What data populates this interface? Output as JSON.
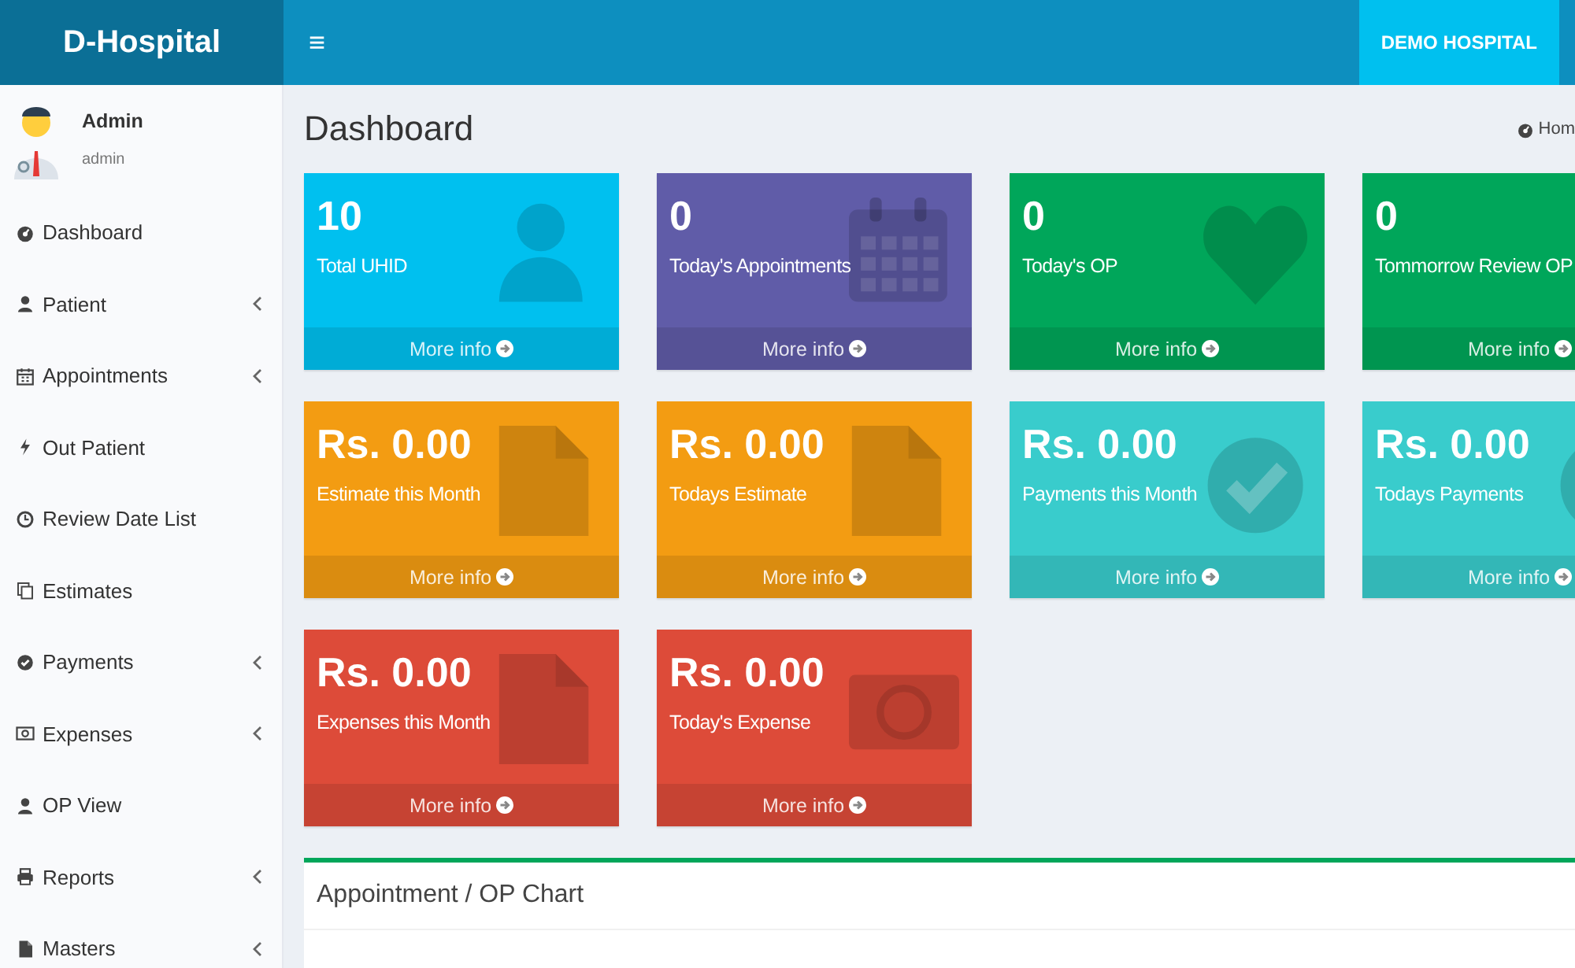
{
  "header": {
    "logo": "D-Hospital",
    "menu_toggle": "≡",
    "hospital_button": "DEMO HOSPITAL"
  },
  "user": {
    "name": "Admin",
    "role": "admin"
  },
  "sidebar": {
    "items": [
      {
        "label": "Dashboard",
        "kind": "dashboard",
        "submenu": false
      },
      {
        "label": "Patient",
        "kind": "user",
        "submenu": true
      },
      {
        "label": "Appointments",
        "kind": "calendar",
        "submenu": true
      },
      {
        "label": "Out Patient",
        "kind": "bolt",
        "submenu": false
      },
      {
        "label": "Review Date List",
        "kind": "clock",
        "submenu": false
      },
      {
        "label": "Estimates",
        "kind": "copy",
        "submenu": false
      },
      {
        "label": "Payments",
        "kind": "check",
        "submenu": true
      },
      {
        "label": "Expenses",
        "kind": "money",
        "submenu": true
      },
      {
        "label": "OP View",
        "kind": "user",
        "submenu": false
      },
      {
        "label": "Reports",
        "kind": "print",
        "submenu": true
      },
      {
        "label": "Masters",
        "kind": "file",
        "submenu": true
      }
    ]
  },
  "page": {
    "title": "Dashboard",
    "breadcrumb": "Hom"
  },
  "cards": [
    {
      "value": "10",
      "label": "Total UHID",
      "link": "More info",
      "color": "#00c0ef",
      "kind": "user"
    },
    {
      "value": "0",
      "label": "Today's Appointments",
      "link": "More info",
      "color": "#605ca8",
      "kind": "calendar"
    },
    {
      "value": "0",
      "label": "Today's OP",
      "link": "More info",
      "color": "#00a65a",
      "kind": "heart"
    },
    {
      "value": "0",
      "label": "Tommorrow Review OP",
      "link": "More info",
      "color": "#00a65a",
      "kind": "none"
    },
    {
      "value": "Rs. 0.00",
      "label": "Estimate this Month",
      "link": "More info",
      "color": "#f39c12",
      "kind": "file"
    },
    {
      "value": "Rs. 0.00",
      "label": "Todays Estimate",
      "link": "More info",
      "color": "#f39c12",
      "kind": "file"
    },
    {
      "value": "Rs. 0.00",
      "label": "Payments this Month",
      "link": "More info",
      "color": "#39cccc",
      "kind": "check"
    },
    {
      "value": "Rs. 0.00",
      "label": "Todays Payments",
      "link": "More info",
      "color": "#39cccc",
      "kind": "check"
    },
    {
      "value": "Rs. 0.00",
      "label": "Expenses this Month",
      "link": "More info",
      "color": "#dd4b39",
      "kind": "file"
    },
    {
      "value": "Rs. 0.00",
      "label": "Today's Expense",
      "link": "More info",
      "color": "#dd4b39",
      "kind": "money"
    }
  ],
  "chart_box": {
    "title": "Appointment / OP Chart"
  }
}
